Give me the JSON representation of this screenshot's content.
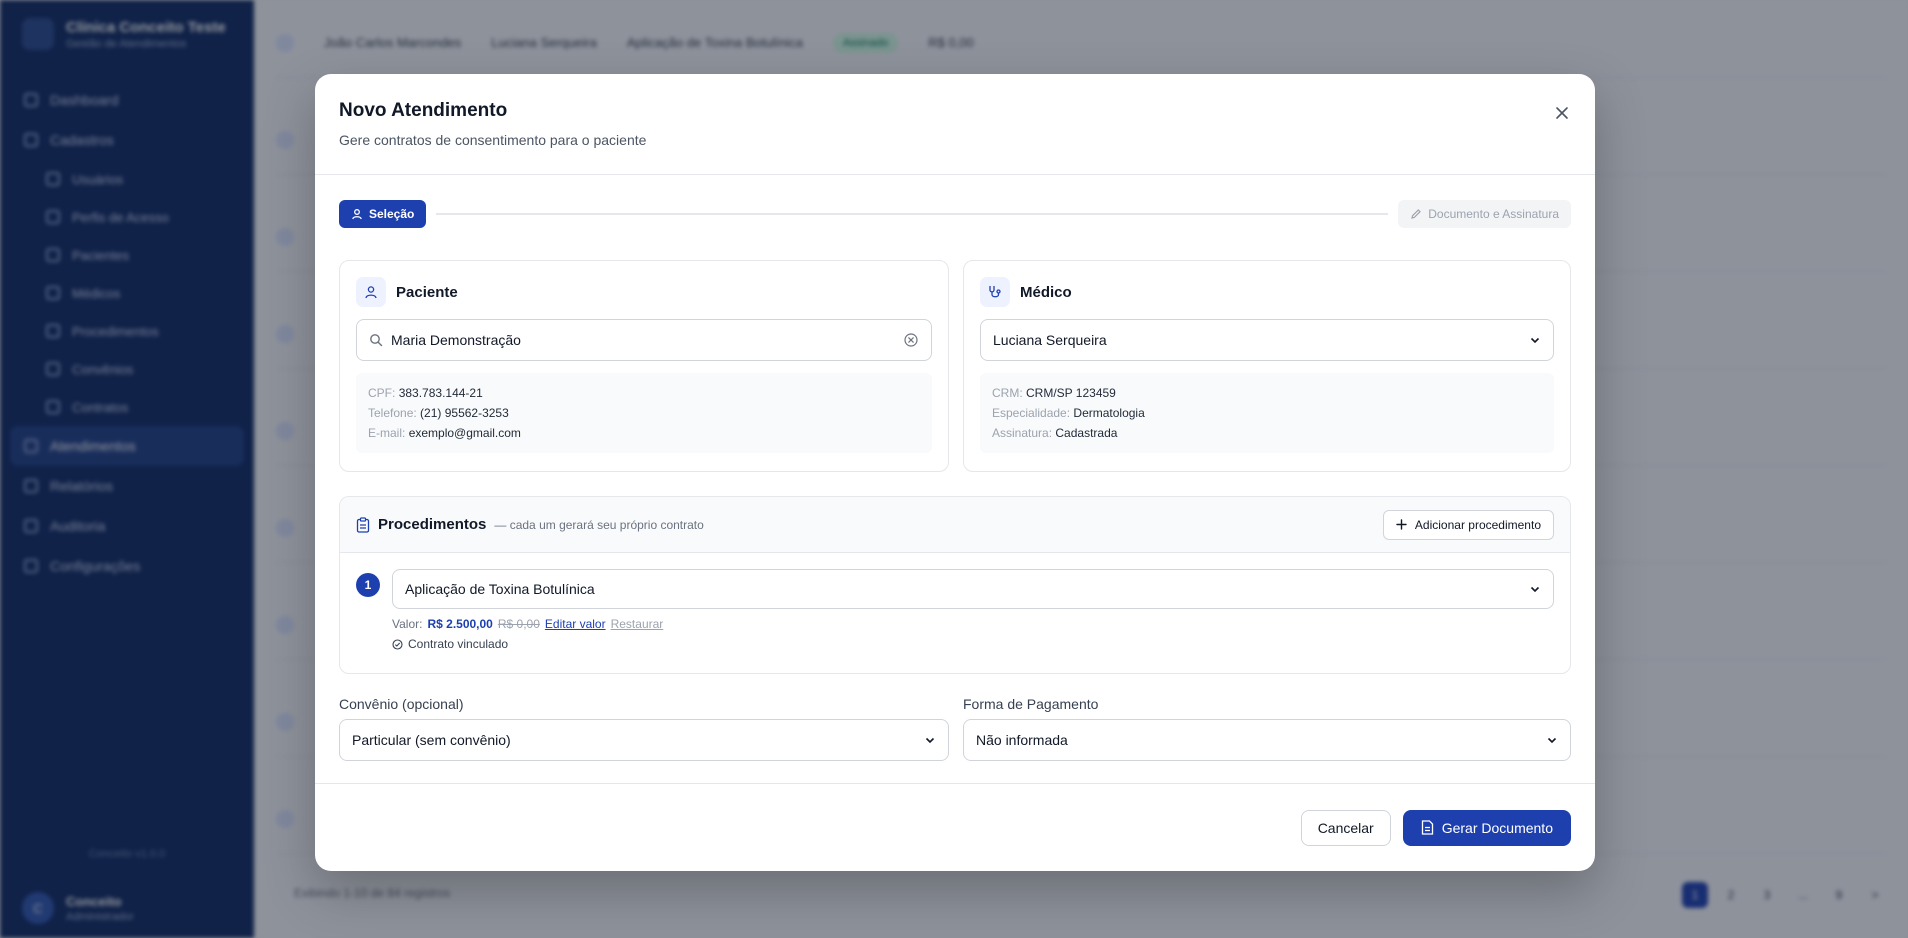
{
  "background": {
    "brand_name": "Clínica Conceito Teste",
    "brand_sub": "Gestão de Atendimentos",
    "nav": [
      {
        "label": "Dashboard",
        "sub": false,
        "active": false
      },
      {
        "label": "Cadastros",
        "sub": false,
        "active": false
      },
      {
        "label": "Usuários",
        "sub": true,
        "active": false
      },
      {
        "label": "Perfis de Acesso",
        "sub": true,
        "active": false
      },
      {
        "label": "Pacientes",
        "sub": true,
        "active": false
      },
      {
        "label": "Médicos",
        "sub": true,
        "active": false
      },
      {
        "label": "Procedimentos",
        "sub": true,
        "active": false
      },
      {
        "label": "Convênios",
        "sub": true,
        "active": false
      },
      {
        "label": "Contratos",
        "sub": true,
        "active": false
      },
      {
        "label": "Atendimentos",
        "sub": false,
        "active": true
      },
      {
        "label": "Relatórios",
        "sub": false,
        "active": false
      },
      {
        "label": "Auditoria",
        "sub": false,
        "active": false
      },
      {
        "label": "Configurações",
        "sub": false,
        "active": false
      }
    ],
    "footer_note": "Conceito v1.0.0",
    "user_initial": "C",
    "user_name": "Conceito",
    "user_role": "Administrador",
    "first_row": {
      "patient": "João Carlos Marcondes",
      "doctor": "Luciana Serqueira",
      "procedure": "Aplicação de Toxina Botulínica",
      "status": "Assinado",
      "value": "R$ 0,00"
    },
    "list_footer": "Exibindo 1-10 de 84 registros",
    "pages": [
      "1",
      "2",
      "3",
      "...",
      "9",
      ">"
    ]
  },
  "modal": {
    "title": "Novo Atendimento",
    "subtitle": "Gere contratos de consentimento para o paciente",
    "steps": {
      "active": "Seleção",
      "inactive": "Documento e Assinatura"
    },
    "patient": {
      "title": "Paciente",
      "search_value": "Maria Demonstração",
      "cpf_label": "CPF:",
      "cpf": "383.783.144-21",
      "phone_label": "Telefone:",
      "phone": "(21) 95562-3253",
      "email_label": "E-mail:",
      "email": "exemplo@gmail.com"
    },
    "doctor": {
      "title": "Médico",
      "selected": "Luciana Serqueira",
      "crm_label": "CRM:",
      "crm": "CRM/SP 123459",
      "specialty_label": "Especialidade:",
      "specialty": "Dermatologia",
      "signature_label": "Assinatura:",
      "signature": "Cadastrada"
    },
    "procedures": {
      "title": "Procedimentos",
      "note": "— cada um gerará seu próprio contrato",
      "add_label": "Adicionar procedimento",
      "items": [
        {
          "number": "1",
          "name": "Aplicação de Toxina Botulínica",
          "value_label": "Valor:",
          "value": "R$ 2.500,00",
          "old_value": "R$ 0,00",
          "edit_label": "Editar valor",
          "restore_label": "Restaurar",
          "contract_status": "Contrato vinculado"
        }
      ]
    },
    "insurance": {
      "label": "Convênio (opcional)",
      "selected": "Particular (sem convênio)"
    },
    "payment": {
      "label": "Forma de Pagamento",
      "selected": "Não informada"
    },
    "cancel_label": "Cancelar",
    "submit_label": "Gerar Documento"
  },
  "colors": {
    "primary": "#1e40af",
    "sidebar": "#0f2a63"
  }
}
